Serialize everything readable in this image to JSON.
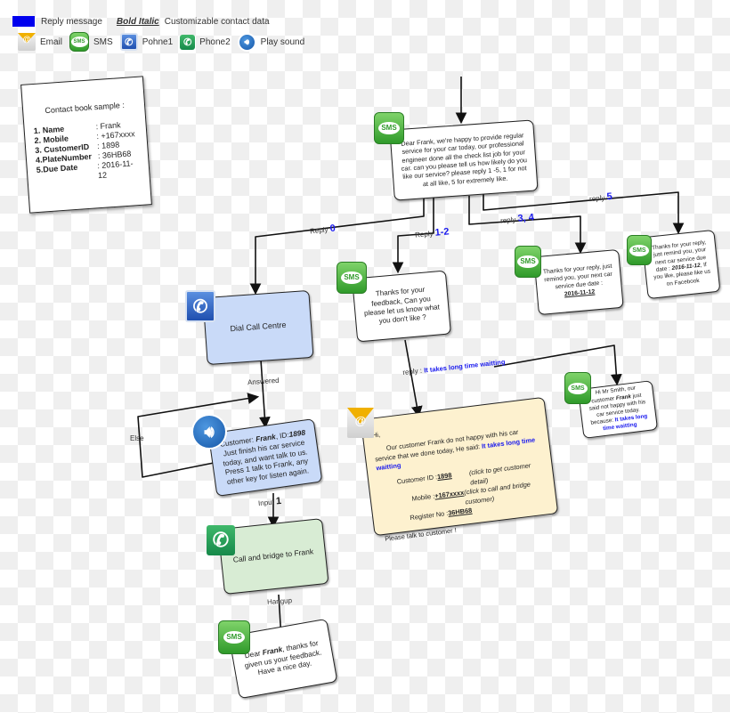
{
  "legend": {
    "reply_message": "Reply message",
    "bold_italic": "Bold Italic",
    "customizable": "Customizable contact data",
    "reply_color": "#0000ee",
    "icons": [
      {
        "icon": "email-icon",
        "label": "Email"
      },
      {
        "icon": "sms-icon",
        "label": "SMS"
      },
      {
        "icon": "phone1-icon",
        "label": "Pohne1"
      },
      {
        "icon": "phone2-icon",
        "label": "Phone2"
      },
      {
        "icon": "play-sound-icon",
        "label": "Play sound"
      }
    ]
  },
  "contact_book": {
    "title": "Contact book sample :",
    "rows": [
      {
        "key": "1. Name",
        "value": ": Frank"
      },
      {
        "key": "2. Mobile",
        "value": ":  +167xxxx"
      },
      {
        "key": "3. CustomerID",
        "value": ": 1898"
      },
      {
        "key": "4.PlateNumber",
        "value": ": 36HB68"
      },
      {
        "key": "5.Due Date",
        "value": ": 2016-11-12"
      }
    ]
  },
  "nodes": {
    "start_sms": {
      "text": "Dear Frank,  we're happy to  provide regular service for your car today, our professional engineer done all the check list job for your car. can you please tell us how likely do you like our service? please reply 1 -5, 1 for not at all like, 5 for extremely like.",
      "icon": "SMS"
    },
    "dial": {
      "text": "Dial Call Centre"
    },
    "play": {
      "prefix": "Customer: ",
      "name": "Frank",
      "id_label": ", ID:",
      "id": "1898",
      "rest": " Just  finish his car service today, and want talk to us. Press 1  talk to Frank, any other key for listen again."
    },
    "bridge": {
      "text": "Call and bridge to Frank"
    },
    "final_sms": {
      "prefix": "Dear ",
      "name": "Frank",
      "rest": ", thanks for given us your feedback. Have a nice day.",
      "icon": "SMS"
    },
    "feedback_sms": {
      "text": "Thanks for your feedback, Can you please let us know what you don't like ?",
      "icon": "SMS"
    },
    "reply34_sms": {
      "text": "Thanks for your reply, just remind you, your next car service due date :",
      "date": "2016-11-12",
      "icon": "SMS"
    },
    "reply5_sms": {
      "text": "Thanks for your reply, just remind you, your next car service due date :",
      "date": "2016-11-12",
      "rest": ",  If you like, please like us on Facebook",
      "icon": "SMS"
    },
    "email": {
      "greeting": "Hi,",
      "line1": "Our customer Frank do not happy with his car service that we done today, He said: ",
      "quote": "It takes long time waitting",
      "fields": [
        {
          "label": "Customer ID : ",
          "value": "1898",
          "note": "(click to get customer detail)"
        },
        {
          "label": "Mobile : ",
          "value": "+167xxxx",
          "note": "(click to call and bridge customer)"
        },
        {
          "label": "Register No : ",
          "value": "36HB68",
          "note": ""
        }
      ],
      "closing": "Please talk to customer  !"
    },
    "smith_sms": {
      "prefix": "Hi Mr Smith, our customer ",
      "name": "Frank",
      "rest": " just said not happy with his car service today.  because:",
      "quote": "It takes long time waitting",
      "icon": "SMS"
    }
  },
  "edges": {
    "reply0": {
      "label": "Reply",
      "num": "0"
    },
    "reply12": {
      "label": "Reply",
      "num": "1-2"
    },
    "reply34": {
      "label": "reply",
      "num": "3, 4"
    },
    "reply5": {
      "label": "reply",
      "num": "5"
    },
    "answered": "Answered",
    "else": "Else",
    "input1": {
      "label": "Input",
      "num": "1"
    },
    "hangup": "Hangup",
    "reply_wait": {
      "label": "reply : ",
      "quote": "It takes long time waitting"
    }
  }
}
